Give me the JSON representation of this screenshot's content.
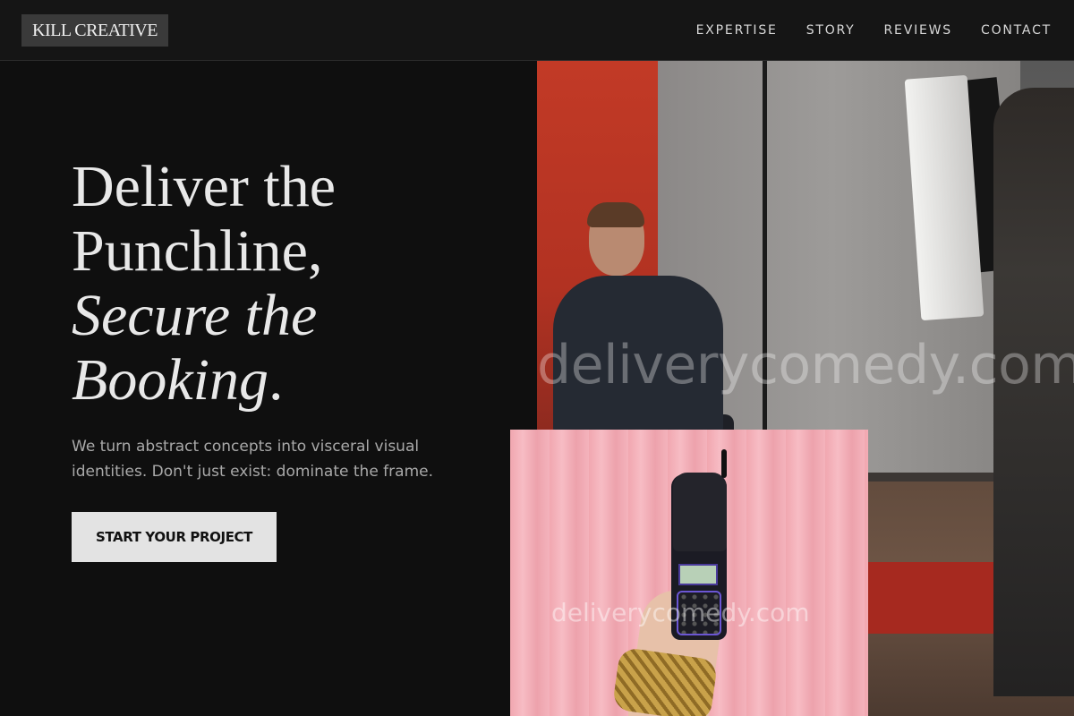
{
  "header": {
    "logo": "KILL CREATIVE",
    "nav": [
      {
        "label": "EXPERTISE"
      },
      {
        "label": "STORY"
      },
      {
        "label": "REVIEWS"
      },
      {
        "label": "CONTACT"
      }
    ]
  },
  "hero": {
    "title_line1": "Deliver the",
    "title_line2": "Punchline,",
    "title_line3": "Secure the",
    "title_line4": "Booking",
    "title_period": ".",
    "subtitle_line1": "We turn abstract concepts into visceral visual",
    "subtitle_line2": "identities. Don't just exist: dominate the frame.",
    "cta_label": "START YOUR PROJECT"
  },
  "images": {
    "watermark_main": "deliverycomedy.com",
    "watermark_inset": "deliverycomedy.com"
  },
  "colors": {
    "background": "#0f0f0f",
    "cta_background": "#e3e3e3",
    "backdrop_red": "#c23a26",
    "inset_pink": "#f4b3bc"
  }
}
